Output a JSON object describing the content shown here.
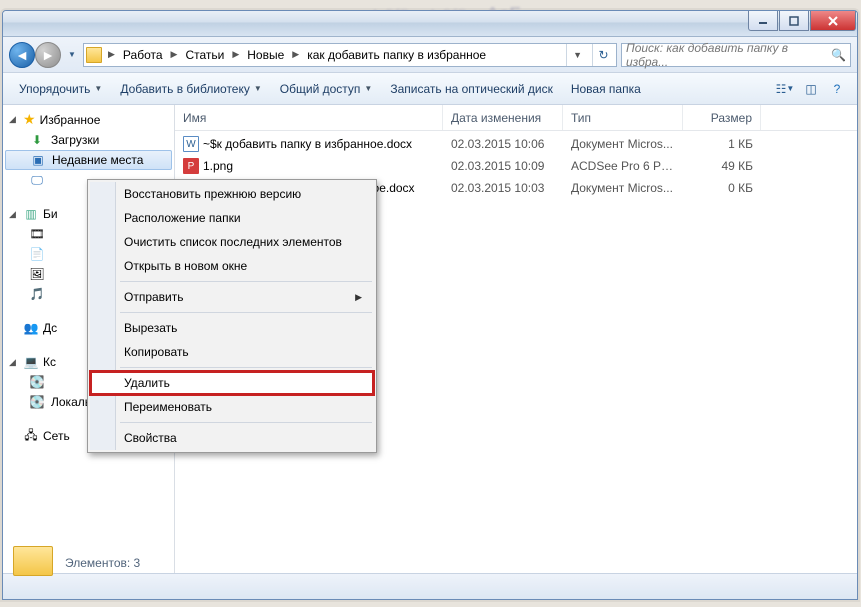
{
  "window_controls": {
    "min": "minimize",
    "max": "maximize",
    "close": "close"
  },
  "breadcrumb": [
    "Работа",
    "Статьи",
    "Новые",
    "как добавить папку в избранное"
  ],
  "search_placeholder": "Поиск: как добавить папку в избра...",
  "toolbar": {
    "organize": "Упорядочить",
    "add_library": "Добавить в библиотеку",
    "share": "Общий доступ",
    "burn": "Записать на оптический диск",
    "new_folder": "Новая папка"
  },
  "sidebar": {
    "favorites": "Избранное",
    "downloads": "Загрузки",
    "recent": "Недавние места",
    "libs_letter": "Би",
    "home_letter": "Дс",
    "computer_letter": "Кс",
    "localdisk": "Локальный диск (D",
    "network": "Сеть"
  },
  "columns": {
    "name": "Имя",
    "date": "Дата изменения",
    "type": "Тип",
    "size": "Размер"
  },
  "rows": [
    {
      "icon": "docx",
      "name": "~$к добавить папку в избранное.docx",
      "date": "02.03.2015 10:06",
      "type": "Документ Micros...",
      "size": "1 КБ"
    },
    {
      "icon": "png",
      "name": "1.png",
      "date": "02.03.2015 10:09",
      "type": "ACDSee Pro 6 PN...",
      "size": "49 КБ"
    },
    {
      "icon": "docx",
      "name": "ое.docx",
      "date": "02.03.2015 10:03",
      "type": "Документ Micros...",
      "size": "0 КБ"
    }
  ],
  "context_menu": {
    "restore": "Восстановить прежнюю версию",
    "location": "Расположение папки",
    "clear": "Очистить список последних элементов",
    "open_new": "Открыть в новом окне",
    "send_to": "Отправить",
    "cut": "Вырезать",
    "copy": "Копировать",
    "delete": "Удалить",
    "rename": "Переименовать",
    "properties": "Свойства"
  },
  "status": {
    "elements": "Элементов: 3"
  }
}
